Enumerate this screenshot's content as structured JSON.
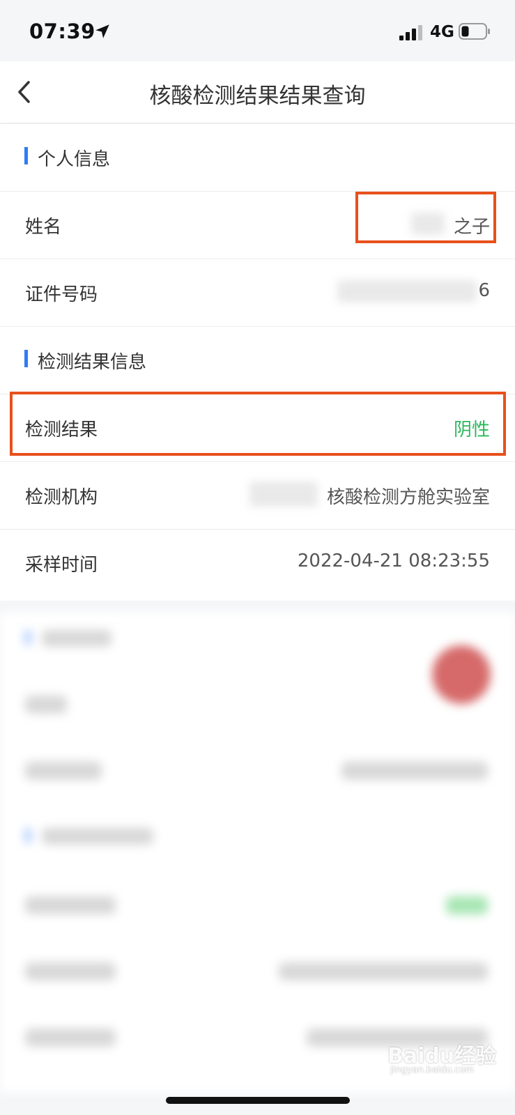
{
  "status_bar": {
    "time": "07:39",
    "network": "4G",
    "location_icon": "location-arrow-icon",
    "signal_icon": "signal-bars-icon",
    "battery_icon": "battery-icon"
  },
  "nav": {
    "title": "核酸检测结果结果查询",
    "back_icon": "chevron-left-icon"
  },
  "sections": {
    "personal": {
      "title": "个人信息",
      "name_label": "姓名",
      "name_value": "之子",
      "id_label": "证件号码",
      "id_value": "6"
    },
    "result": {
      "title": "检测结果信息",
      "result_label": "检测结果",
      "result_value": "阴性",
      "institution_label": "检测机构",
      "institution_value": "核酸检测方舱实验室",
      "time_label": "采样时间",
      "time_value": "2022-04-21 08:23:55"
    }
  },
  "watermark": {
    "text": "Baidu经验",
    "subtext": "jingyan.baidu.com"
  },
  "colors": {
    "accent_blue": "#2f7cf6",
    "negative_green": "#2cb85c",
    "highlight_orange": "#e8501c"
  }
}
